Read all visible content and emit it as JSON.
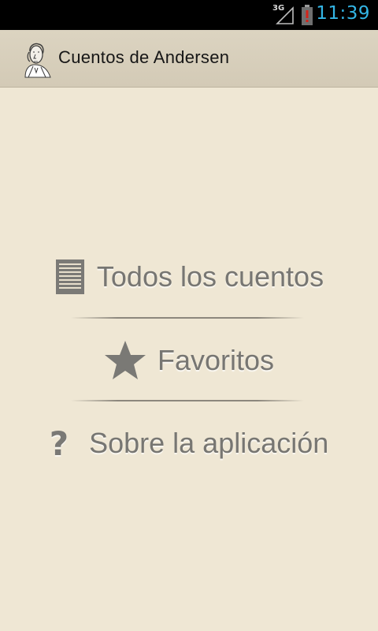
{
  "status_bar": {
    "network": "3G",
    "time": "11:39",
    "signal_icon": "signal-icon",
    "battery_icon": "battery-low-icon",
    "colors": {
      "clock": "#33b5e5",
      "battery_alert": "#d4231a"
    }
  },
  "action_bar": {
    "title": "Cuentos de Andersen",
    "logo_icon": "andersen-portrait-icon"
  },
  "menu": {
    "items": [
      {
        "label": "Todos los cuentos",
        "icon": "list-document-icon"
      },
      {
        "label": "Favoritos",
        "icon": "star-icon"
      },
      {
        "label": "Sobre la aplicación",
        "icon": "question-mark-icon"
      }
    ]
  },
  "colors": {
    "background": "#efe7d4",
    "action_bar": "#d8cfbc",
    "menu_text": "#777672"
  }
}
